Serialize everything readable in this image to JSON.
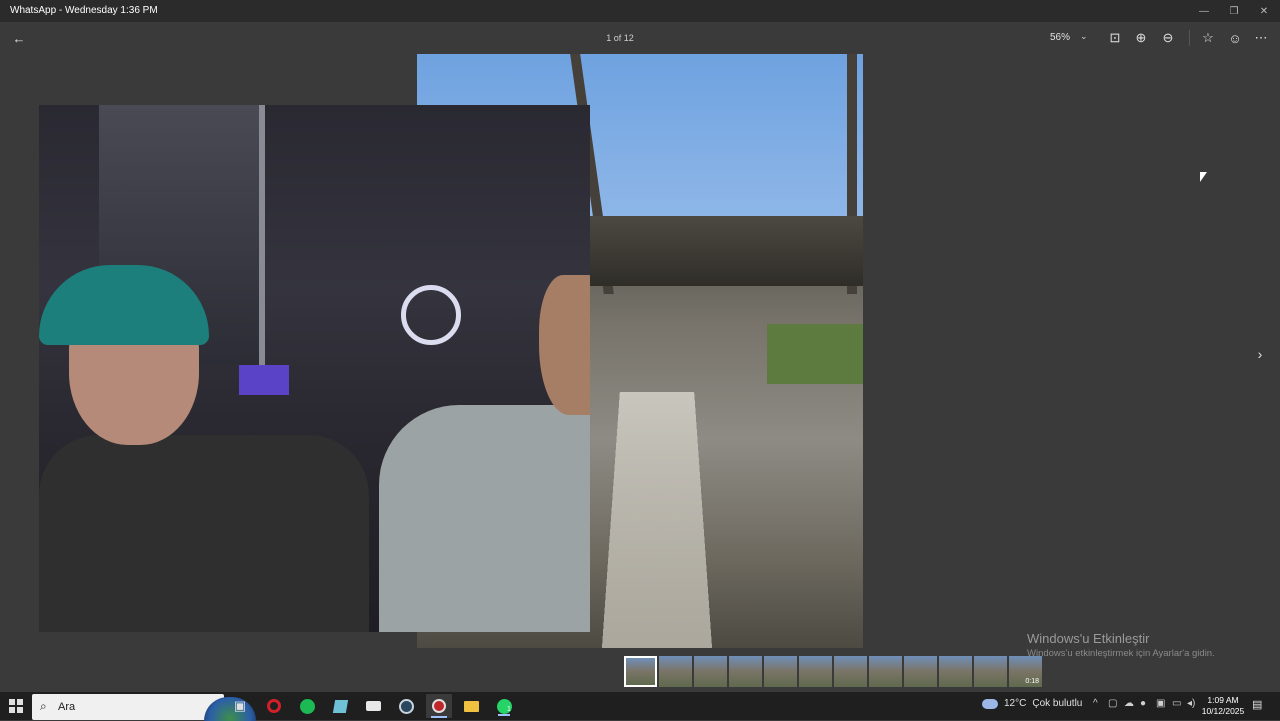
{
  "window": {
    "title": "WhatsApp - Wednesday 1:36 PM"
  },
  "viewer": {
    "counter": "1 of 12",
    "zoom_level": "56%",
    "activation": {
      "title": "Windows'u Etkinleştir",
      "subtitle": "Windows'u etkinleştirmek için Ayarlar'a gidin."
    },
    "filmstrip": {
      "selected_index": 0,
      "video_duration": "0:18",
      "count": 12
    }
  },
  "icons": {
    "back": "←",
    "minimize": "—",
    "restore": "❐",
    "close": "✕",
    "fit": "⊡",
    "zoom_in": "⊕",
    "zoom_out": "⊖",
    "star": "☆",
    "emoji": "☺",
    "more": "⋯",
    "next": "›",
    "caret": "⌄"
  },
  "taskbar": {
    "search_placeholder": "Ara",
    "weather": {
      "temp": "12°C",
      "condition": "Çok bulutlu"
    },
    "clock": {
      "time": "1:09 AM",
      "date": "10/12/2025"
    },
    "badge": "1"
  },
  "colors": {
    "toolbar_bg": "#3a3a3a",
    "titlebar_bg": "#2b2b2b",
    "taskbar_bg": "#1f1f1f",
    "accent": "#9ec0ff"
  }
}
